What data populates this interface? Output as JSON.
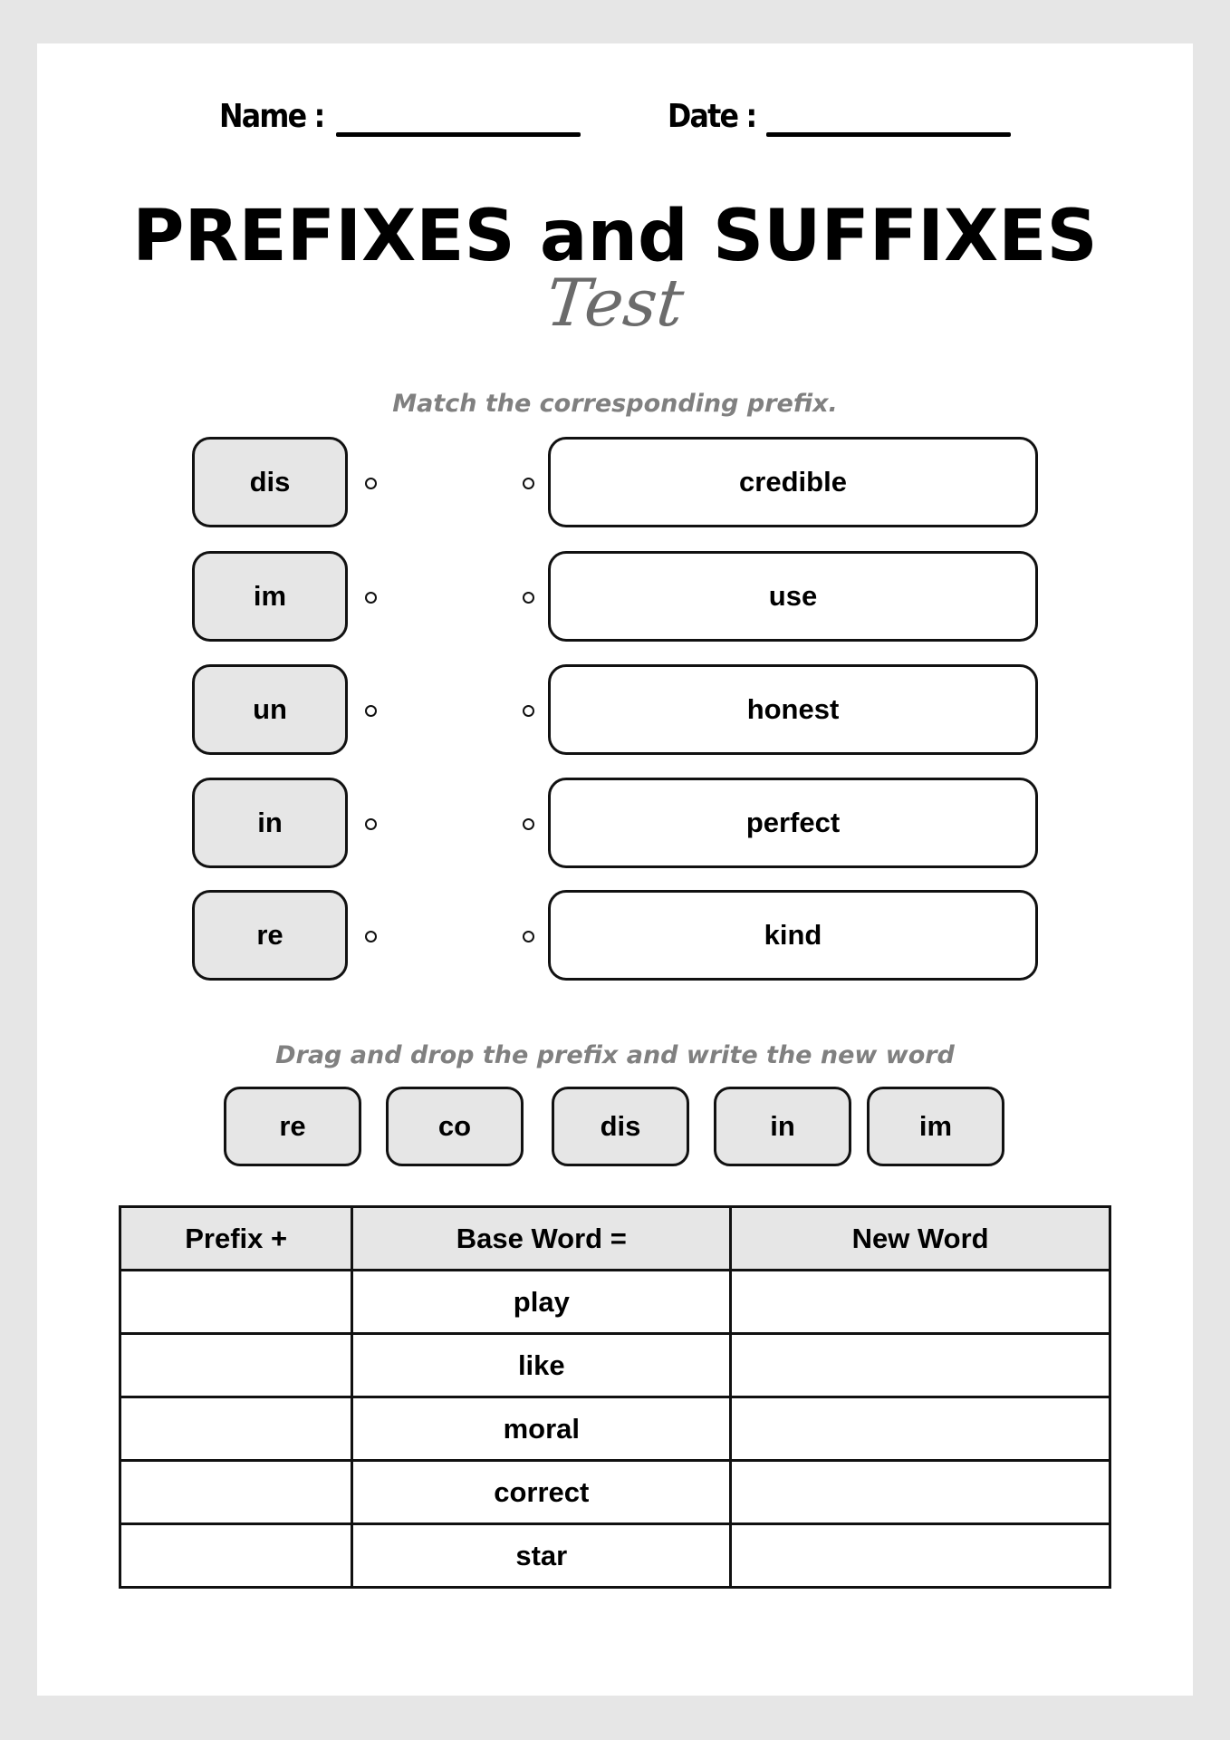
{
  "header": {
    "name_label": "Name :",
    "date_label": "Date :"
  },
  "title": "PREFIXES and SUFFIXES",
  "subtitle": "Test",
  "matching": {
    "instruction": "Match the corresponding prefix.",
    "prefixes": [
      "dis",
      "im",
      "un",
      "in",
      "re"
    ],
    "words": [
      "credible",
      "use",
      "honest",
      "perfect",
      "kind"
    ]
  },
  "drag_drop": {
    "instruction": "Drag and drop the prefix and write the new word",
    "chips": [
      "re",
      "co",
      "dis",
      "in",
      "im"
    ]
  },
  "table": {
    "headers": [
      "Prefix +",
      "Base Word =",
      "New Word"
    ],
    "rows": [
      {
        "prefix": "",
        "base": "play",
        "new": ""
      },
      {
        "prefix": "",
        "base": "like",
        "new": ""
      },
      {
        "prefix": "",
        "base": "moral",
        "new": ""
      },
      {
        "prefix": "",
        "base": "correct",
        "new": ""
      },
      {
        "prefix": "",
        "base": "star",
        "new": ""
      }
    ]
  },
  "colors": {
    "background": "#e6e6e6",
    "page": "#ffffff",
    "box_fill": "#e6e6e6",
    "instruction_text": "#808080",
    "subtitle_text": "#6b6b6b"
  }
}
